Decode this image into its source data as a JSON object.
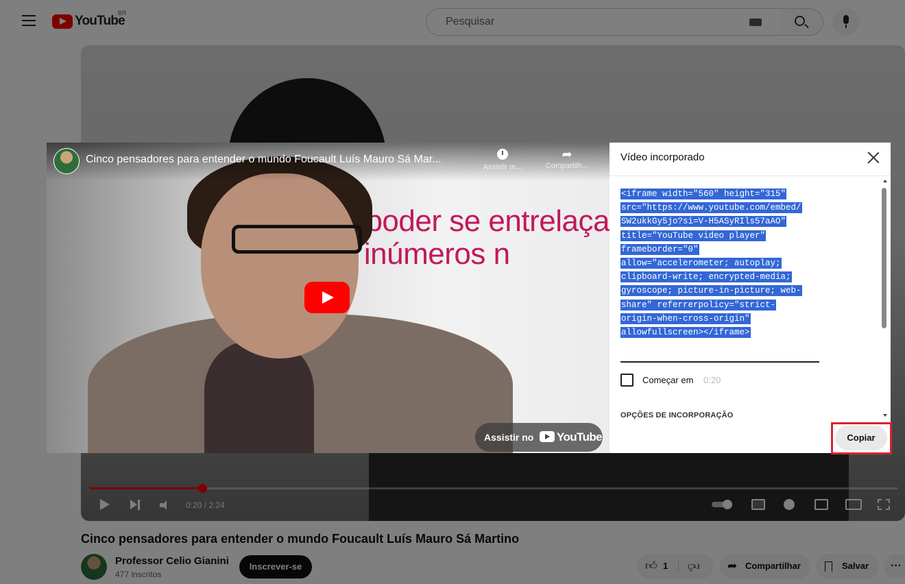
{
  "masthead": {
    "logo_text": "YouTube",
    "country_code": "BR",
    "search_placeholder": "Pesquisar"
  },
  "player": {
    "time_display": "0:20 / 2:24",
    "progress_fraction": 0.139
  },
  "video": {
    "title": "Cinco pensadores para entender o mundo Foucault Luís Mauro Sá Martino"
  },
  "channel": {
    "name": "Professor Celio Gianini",
    "subscribers": "477 inscritos",
    "subscribe_label": "Inscrever-se"
  },
  "actions": {
    "like_count": "1",
    "share_label": "Compartilhar",
    "save_label": "Salvar",
    "more_label": "···"
  },
  "embed_preview": {
    "title": "Cinco pensadores para entender o mundo Foucault Luís Mauro Sá Mar...",
    "watch_later_label": "Assistir m...",
    "share_label": "Compartilh...",
    "slide_line_1": "O poder se entrelaça",
    "slide_line_2": "m inúmeros n",
    "watch_on_label": "Assistir no",
    "watch_on_brand": "YouTube"
  },
  "embed_panel": {
    "title": "Vídeo incorporado",
    "code_lines": [
      "<iframe width=\"560\" height=\"315\"",
      "src=\"https://www.youtube.com/embed/",
      "SW2ukkGy5jo?si=V-H5ASyRIls57aAO\"",
      "title=\"YouTube video player\"",
      "frameborder=\"0\"",
      "allow=\"accelerometer; autoplay;",
      "clipboard-write; encrypted-media;",
      "gyroscope; picture-in-picture; web-",
      "share\" referrerpolicy=\"strict-",
      "origin-when-cross-origin\"",
      "allowfullscreen></iframe>"
    ],
    "start_at_label": "Começar em",
    "start_at_time": "0:20",
    "options_heading": "OPÇÕES DE INCORPORAÇÃO",
    "copy_label": "Copiar"
  },
  "colors": {
    "brand_red": "#ff0000",
    "selection_blue": "#3367d6",
    "highlight_red": "#d6262e"
  }
}
